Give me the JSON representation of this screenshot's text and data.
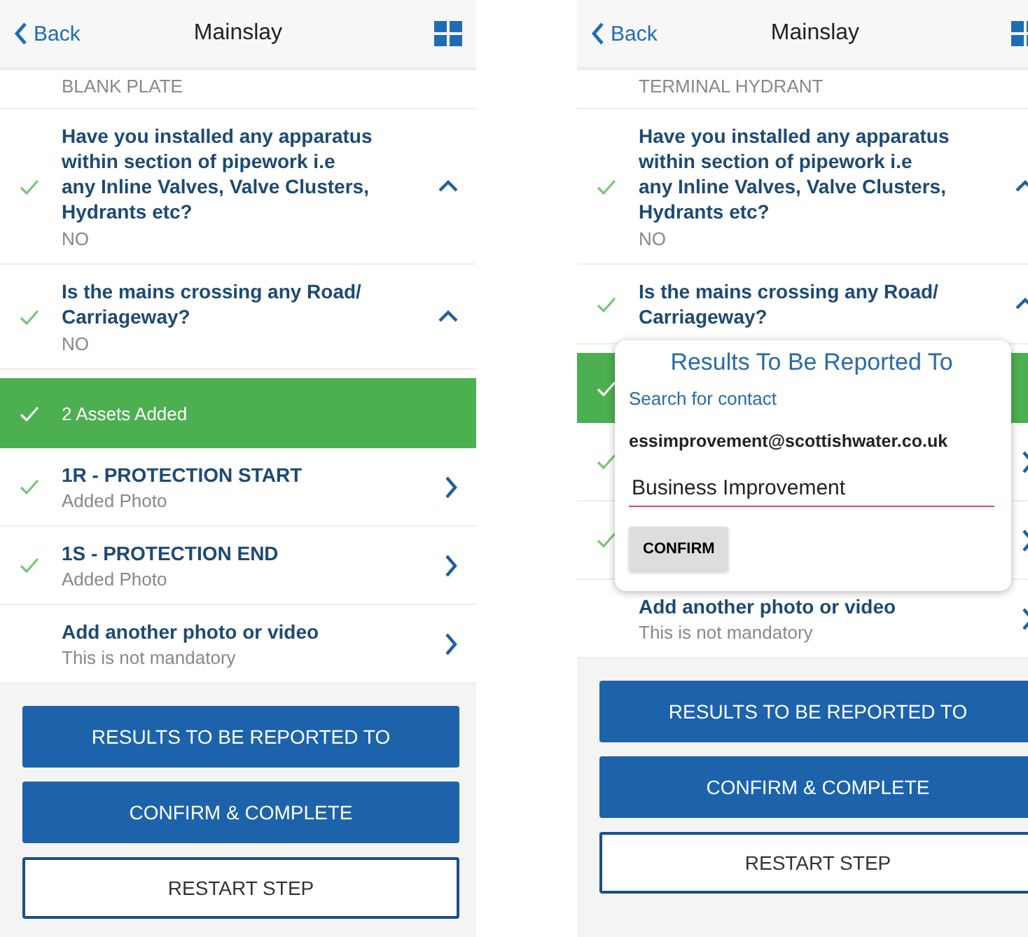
{
  "screens": [
    {
      "header": {
        "back": "Back",
        "title": "Mainslay"
      },
      "previous_answer": "BLANK PLATE",
      "questions": [
        {
          "text": "Have you installed any apparatus within section of pipework i.e any Inline Valves, Valve Clusters, Hydrants etc?",
          "answer": "NO",
          "done": true,
          "expanded": true
        },
        {
          "text": "Is the mains crossing any Road/ Carriageway?",
          "answer": "NO",
          "done": true,
          "expanded": true
        }
      ],
      "assets_bar": {
        "text": "2 Assets Added",
        "done": true
      },
      "rows": [
        {
          "title": "1R - PROTECTION START",
          "subtitle": "Added Photo",
          "done": true
        },
        {
          "title": "1S - PROTECTION END",
          "subtitle": "Added Photo",
          "done": true
        },
        {
          "title": "Add another photo or video",
          "subtitle": "This is not mandatory",
          "done": false
        }
      ],
      "buttons": [
        {
          "label": "RESULTS TO BE REPORTED TO",
          "kind": "primary"
        },
        {
          "label": "CONFIRM & COMPLETE",
          "kind": "primary"
        },
        {
          "label": "RESTART STEP",
          "kind": "outline"
        }
      ]
    },
    {
      "header": {
        "back": "Back",
        "title": "Mainslay"
      },
      "previous_answer": "TERMINAL HYDRANT",
      "questions": [
        {
          "text": "Have you installed any apparatus within section of pipework i.e any Inline Valves, Valve Clusters, Hydrants etc?",
          "answer": "NO",
          "done": true,
          "expanded": true
        },
        {
          "text": "Is the mains crossing any Road/ Carriageway?",
          "done": true,
          "expanded": true
        }
      ],
      "assets_bar": {
        "done": true
      },
      "rows": [
        {
          "done": true
        },
        {
          "done": true
        },
        {
          "title": "Add another photo or video",
          "subtitle": "This is not mandatory",
          "done": false
        }
      ],
      "buttons": [
        {
          "label": "RESULTS TO BE REPORTED TO",
          "kind": "primary"
        },
        {
          "label": "CONFIRM & COMPLETE",
          "kind": "primary"
        },
        {
          "label": "RESTART STEP",
          "kind": "outline"
        }
      ],
      "dialog": {
        "title": "Results To Be Reported To",
        "label": "Search for contact",
        "email": "essimprovement@scottishwater.co.uk",
        "value": "Business Improvement",
        "button": "CONFIRM"
      }
    }
  ]
}
